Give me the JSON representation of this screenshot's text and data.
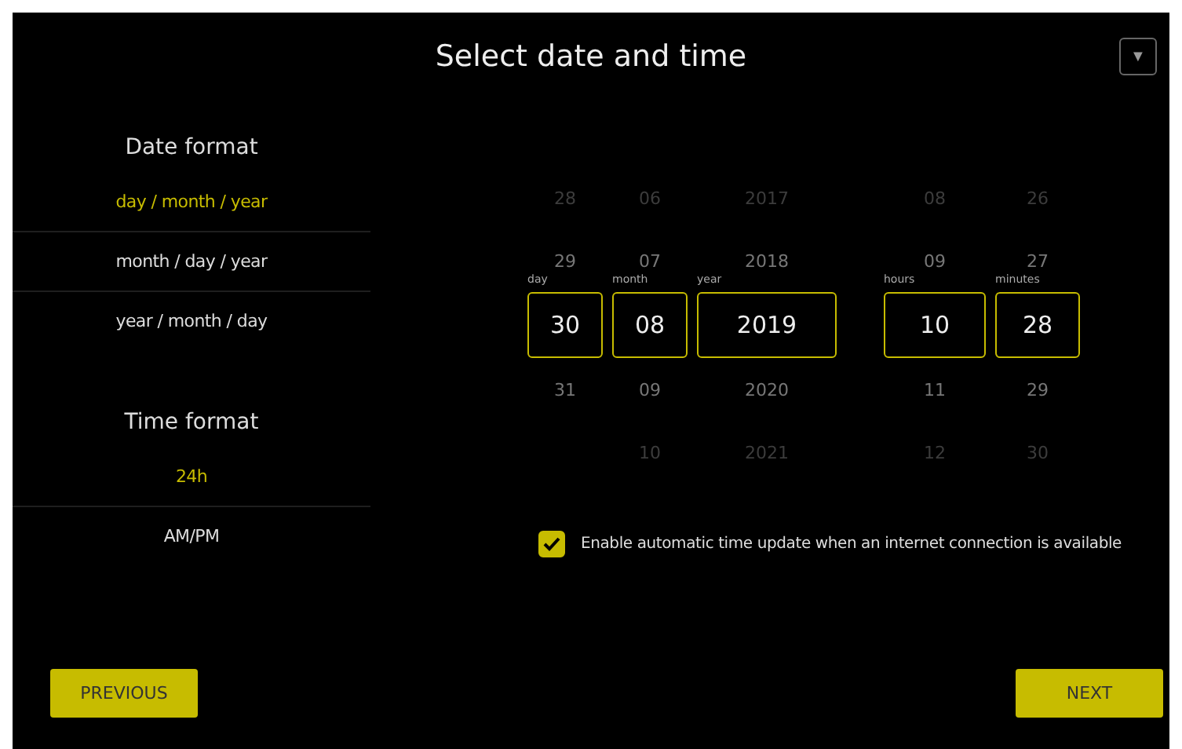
{
  "window": {
    "title": "Select date and time",
    "menu_button": "▼"
  },
  "date_format": {
    "heading": "Date format",
    "options": [
      {
        "label": "day / month / year",
        "selected": true
      },
      {
        "label": "month / day / year",
        "selected": false
      },
      {
        "label": "year / month / day",
        "selected": false
      }
    ]
  },
  "time_format": {
    "heading": "Time format",
    "options": [
      {
        "label": "24h",
        "selected": true
      },
      {
        "label": "AM/PM",
        "selected": false
      }
    ]
  },
  "date_wheels": [
    {
      "label": "day",
      "before": [
        "28",
        "29"
      ],
      "value": "30",
      "after": [
        "31"
      ]
    },
    {
      "label": "month",
      "before": [
        "06",
        "07"
      ],
      "value": "08",
      "after": [
        "09",
        "10"
      ]
    },
    {
      "label": "year",
      "before": [
        "2017",
        "2018"
      ],
      "value": "2019",
      "after": [
        "2020",
        "2021"
      ]
    }
  ],
  "time_wheels": [
    {
      "label": "hours",
      "before": [
        "08",
        "09"
      ],
      "value": "10",
      "after": [
        "11",
        "12"
      ]
    },
    {
      "label": "minutes",
      "before": [
        "26",
        "27"
      ],
      "value": "28",
      "after": [
        "29",
        "30"
      ]
    }
  ],
  "auto_update": {
    "checked": true,
    "label": "Enable automatic time update when an internet connection is available"
  },
  "buttons": {
    "previous": "PREVIOUS",
    "next": "NEXT"
  }
}
